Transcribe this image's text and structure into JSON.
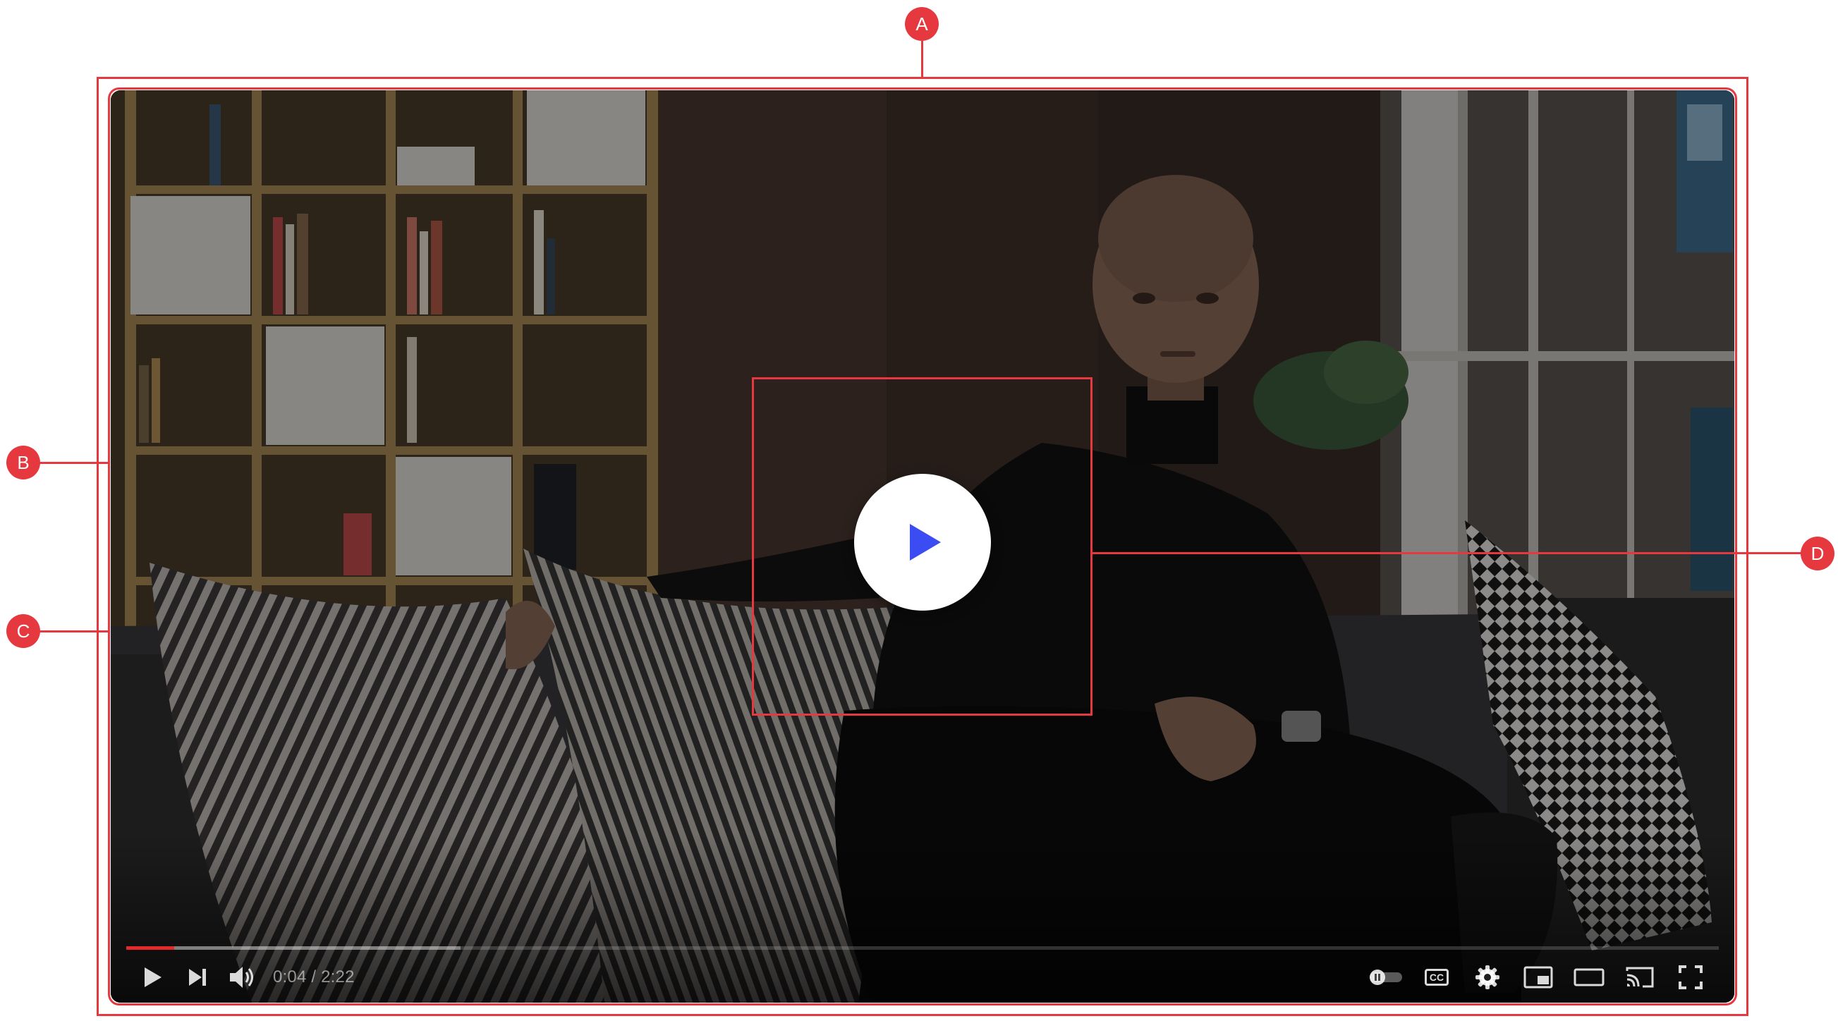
{
  "annotations": {
    "a": "A",
    "b": "B",
    "c": "C",
    "d": "D"
  },
  "player": {
    "progress_fraction": 0.03,
    "buffered_fraction": 0.21,
    "time_display": "0:04 / 2:22",
    "accent_color": "#e22a2a",
    "play_icon_color": "#3b4cf2",
    "controls_left": [
      "play-icon",
      "next-icon",
      "volume-icon"
    ],
    "controls_right": [
      "autoplay-toggle-icon",
      "captions-icon",
      "settings-gear-icon",
      "miniplayer-icon",
      "theater-mode-icon",
      "cast-icon",
      "fullscreen-icon"
    ],
    "captions_label": "CC"
  },
  "annotation_color": "#e5393f"
}
